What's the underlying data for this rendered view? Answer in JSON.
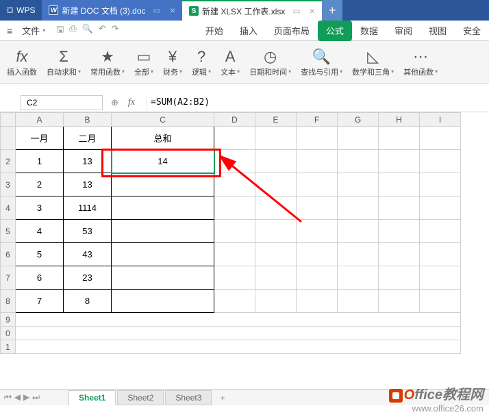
{
  "titlebar": {
    "wps_label": "WPS",
    "doc_label": "新建 DOC 文档 (3).doc",
    "xlsx_label": "新建 XLSX 工作表.xlsx"
  },
  "menubar": {
    "file": "文件",
    "tabs": {
      "start": "开始",
      "insert": "插入",
      "layout": "页面布局",
      "formula": "公式",
      "data": "数据",
      "review": "审阅",
      "view": "视图",
      "security": "安全"
    }
  },
  "ribbon": {
    "insert_fn": "插入函数",
    "autosum": "自动求和",
    "common": "常用函数",
    "all": "全部",
    "financial": "财务",
    "logical": "逻辑",
    "text": "文本",
    "datetime": "日期和时间",
    "lookup": "查找与引用",
    "math": "数学和三角",
    "other": "其他函数"
  },
  "formula_bar": {
    "cell_ref": "C2",
    "formula": "=SUM(A2:B2)"
  },
  "columns": [
    "A",
    "B",
    "C",
    "D",
    "E",
    "F",
    "G",
    "H",
    "I"
  ],
  "rows_visible": [
    "",
    "2",
    "3",
    "4",
    "5",
    "6",
    "7",
    "8",
    "9",
    "0",
    "1"
  ],
  "headers": {
    "a": "一月",
    "b": "二月",
    "c": "总和"
  },
  "data": [
    {
      "a": "1",
      "b": "13",
      "c": "14"
    },
    {
      "a": "2",
      "b": "13",
      "c": ""
    },
    {
      "a": "3",
      "b": "1114",
      "c": ""
    },
    {
      "a": "4",
      "b": "53",
      "c": ""
    },
    {
      "a": "5",
      "b": "43",
      "c": ""
    },
    {
      "a": "6",
      "b": "23",
      "c": ""
    },
    {
      "a": "7",
      "b": "8",
      "c": ""
    }
  ],
  "sheets": {
    "s1": "Sheet1",
    "s2": "Sheet2",
    "s3": "Sheet3"
  },
  "watermark": {
    "brand": "Office",
    "suffix": "教程网",
    "url": "www.office26.com"
  }
}
